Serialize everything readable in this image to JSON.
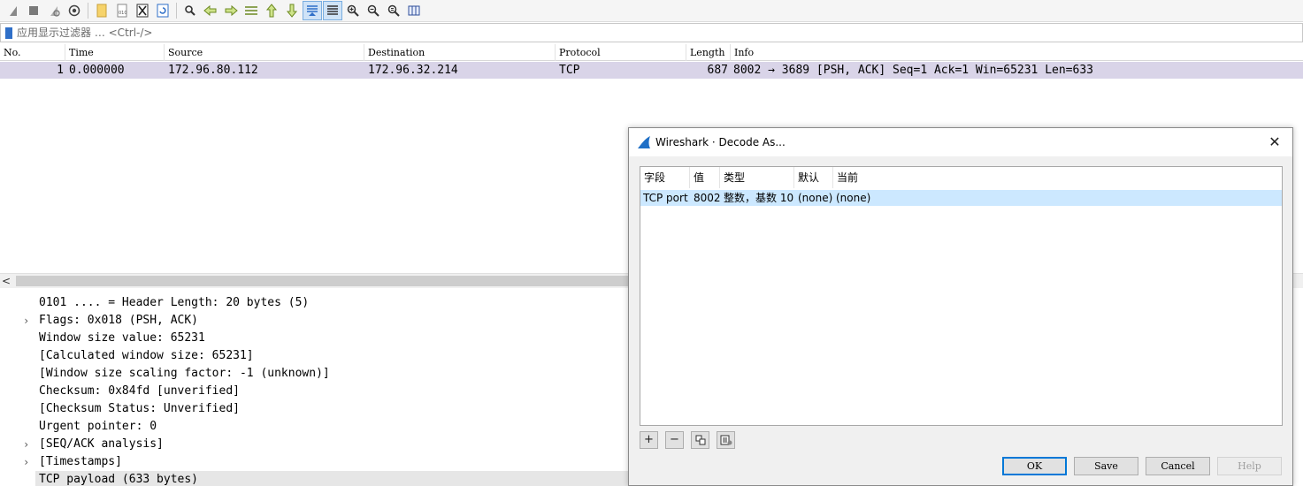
{
  "toolbar": {
    "icons": [
      "shark-fin-start-icon",
      "stop-icon",
      "restart-icon",
      "options-icon",
      "open-file-icon",
      "save-file-icon",
      "close-file-icon",
      "reload-icon",
      "find-icon",
      "back-icon",
      "forward-icon",
      "go-to-packet-icon",
      "first-packet-icon",
      "last-packet-icon",
      "autoscroll-icon",
      "colorize-icon",
      "zoom-in-icon",
      "zoom-out-icon",
      "normal-size-icon",
      "resize-columns-icon"
    ]
  },
  "filter": {
    "placeholder": "应用显示过滤器 … <Ctrl-/>"
  },
  "packet_list": {
    "columns": [
      "No.",
      "Time",
      "Source",
      "Destination",
      "Protocol",
      "Length",
      "Info"
    ],
    "rows": [
      {
        "no": "1",
        "time": "0.000000",
        "source": "172.96.80.112",
        "destination": "172.96.32.214",
        "protocol": "TCP",
        "length": "687",
        "info": "8002 → 3689 [PSH, ACK] Seq=1 Ack=1 Win=65231 Len=633"
      }
    ]
  },
  "details": {
    "lines": [
      {
        "text": "0101 .... = Header Length: 20 bytes (5)",
        "expandable": false
      },
      {
        "text": "Flags: 0x018 (PSH, ACK)",
        "expandable": true
      },
      {
        "text": "Window size value: 65231",
        "expandable": false
      },
      {
        "text": "[Calculated window size: 65231]",
        "expandable": false
      },
      {
        "text": "[Window size scaling factor: -1 (unknown)]",
        "expandable": false
      },
      {
        "text": "Checksum: 0x84fd [unverified]",
        "expandable": false
      },
      {
        "text": "[Checksum Status: Unverified]",
        "expandable": false
      },
      {
        "text": "Urgent pointer: 0",
        "expandable": false
      },
      {
        "text": "[SEQ/ACK analysis]",
        "expandable": true
      },
      {
        "text": "[Timestamps]",
        "expandable": true
      },
      {
        "text": "TCP payload (633 bytes)",
        "expandable": false,
        "selected": true
      }
    ]
  },
  "dialog": {
    "title": "Wireshark · Decode As...",
    "close_glyph": "✕",
    "columns": [
      "字段",
      "值",
      "类型",
      "默认",
      "当前"
    ],
    "rows": [
      {
        "field": "TCP port",
        "value": "8002",
        "type": "整数，基数 10",
        "default": "(none)",
        "current": "(none)"
      }
    ],
    "tool_buttons": [
      "+",
      "−",
      "copy-icon",
      "clear-list-icon"
    ],
    "buttons": {
      "ok": "OK",
      "save": "Save",
      "cancel": "Cancel",
      "help": "Help"
    }
  },
  "colors": {
    "selected_packet_row": "#d9d4e8",
    "dialog_selected_row": "#cce8ff",
    "primary_button_border": "#0078d7"
  }
}
